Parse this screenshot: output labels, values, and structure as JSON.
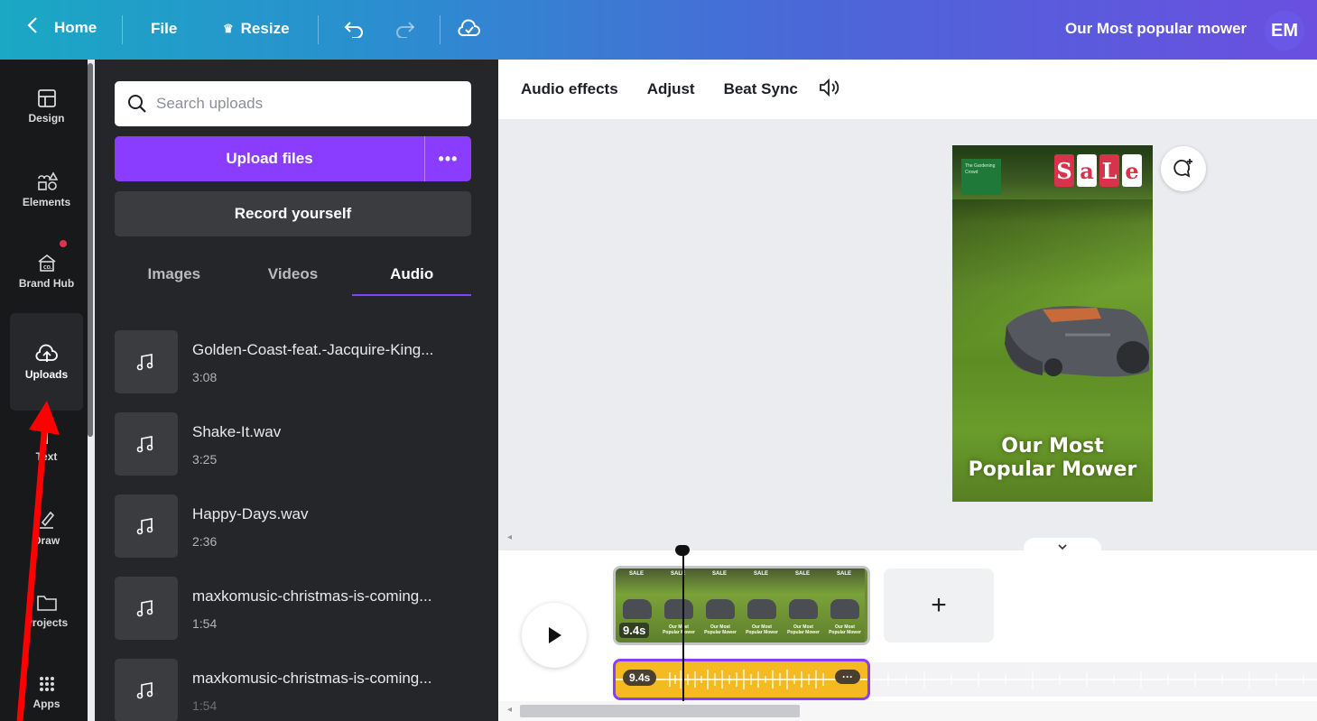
{
  "topbar": {
    "home_label": "Home",
    "file_label": "File",
    "resize_label": "Resize",
    "project_title": "Our Most popular mower",
    "avatar_initials": "EM",
    "icons": [
      "chevron-left-icon",
      "crown-icon",
      "undo-icon",
      "redo-icon",
      "cloud-saved-icon"
    ]
  },
  "rail": {
    "items": [
      {
        "label": "Design",
        "icon": "layout-icon"
      },
      {
        "label": "Elements",
        "icon": "shapes-icon"
      },
      {
        "label": "Brand Hub",
        "icon": "brand-hub-icon"
      },
      {
        "label": "Uploads",
        "icon": "cloud-upload-icon",
        "active": true
      },
      {
        "label": "Text",
        "icon": "text-icon"
      },
      {
        "label": "Draw",
        "icon": "pen-icon"
      },
      {
        "label": "Projects",
        "icon": "folder-icon"
      },
      {
        "label": "Apps",
        "icon": "apps-grid-icon"
      }
    ]
  },
  "uploads": {
    "search_placeholder": "Search uploads",
    "upload_label": "Upload files",
    "more_label": "•••",
    "record_label": "Record yourself",
    "tabs": [
      {
        "label": "Images"
      },
      {
        "label": "Videos"
      },
      {
        "label": "Audio",
        "active": true
      }
    ],
    "audio_files": [
      {
        "name": "Golden-Coast-feat.-Jacquire-King...",
        "duration": "3:08"
      },
      {
        "name": "Shake-It.wav",
        "duration": "3:25"
      },
      {
        "name": "Happy-Days.wav",
        "duration": "2:36"
      },
      {
        "name": "maxkomusic-christmas-is-coming...",
        "duration": "1:54"
      },
      {
        "name": "maxkomusic-christmas-is-coming...",
        "duration": "1:54"
      }
    ]
  },
  "context_bar": {
    "items": [
      "Audio effects",
      "Adjust",
      "Beat Sync"
    ],
    "volume_icon": "volume-icon"
  },
  "design": {
    "logo_text": "The Gardening Crowd",
    "sale_letters": [
      "S",
      "a",
      "L",
      "e"
    ],
    "title_line1": "Our Most",
    "title_line2": "Popular Mower"
  },
  "timeline": {
    "video_clip_duration": "9.4s",
    "audio_clip_duration": "9.4s",
    "add_label": "+",
    "frame_sale": "SALE",
    "frame_caption": "Our Most Popular Mower"
  },
  "colors": {
    "accent": "#8b3dff",
    "panel_bg": "#252629",
    "rail_bg": "#18191b",
    "audio_track": "#f5b922",
    "annotation": "#ff0000"
  }
}
